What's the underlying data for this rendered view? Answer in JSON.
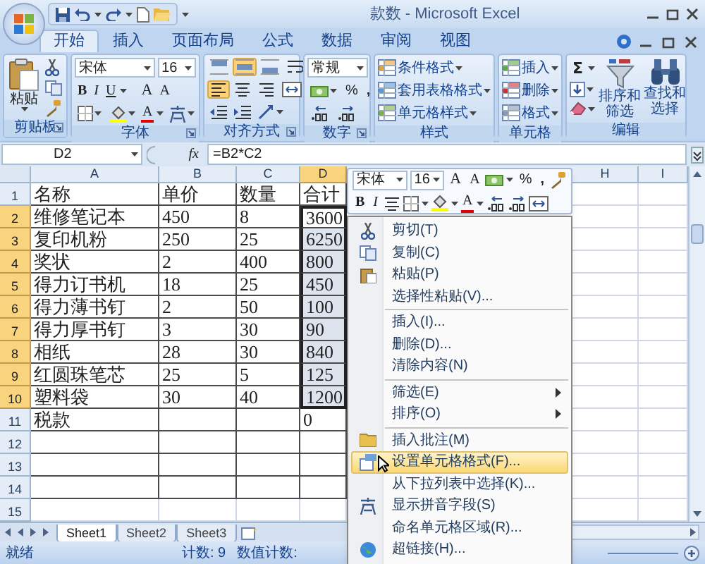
{
  "window": {
    "title": "款数 - Microsoft Excel"
  },
  "ribbon_tabs": [
    {
      "label": "开始",
      "selected": true
    },
    {
      "label": "插入",
      "selected": false
    },
    {
      "label": "页面布局",
      "selected": false
    },
    {
      "label": "公式",
      "selected": false
    },
    {
      "label": "数据",
      "selected": false
    },
    {
      "label": "审阅",
      "selected": false
    },
    {
      "label": "视图",
      "selected": false
    }
  ],
  "ribbon": {
    "clipboard": {
      "label": "剪贴板",
      "paste": "粘贴"
    },
    "font": {
      "label": "字体",
      "font_name": "宋体",
      "font_size": "16",
      "bold": "B",
      "italic": "I",
      "underline": "U",
      "grow_font": "A",
      "shrink_font": "A",
      "font_color": "A"
    },
    "alignment": {
      "label": "对齐方式",
      "vertical_buttons": [
        {
          "selected": false
        },
        {
          "selected": true
        },
        {
          "selected": false
        }
      ],
      "horizontal_buttons": [
        {
          "selected": true
        },
        {
          "selected": false
        },
        {
          "selected": false
        }
      ]
    },
    "number": {
      "label": "数字",
      "format": "常规",
      "percent": "%",
      "comma": ","
    },
    "styles": {
      "label": "样式",
      "items": [
        "条件格式",
        "套用表格格式",
        "单元格样式"
      ]
    },
    "cells": {
      "label": "单元格",
      "items": [
        "插入",
        "删除",
        "格式"
      ]
    },
    "editing": {
      "label": "编辑",
      "sum": "Σ",
      "sort": "排序和筛选",
      "find": "查找和选择"
    }
  },
  "formula_bar": {
    "name_box": "D2",
    "fx": "fx",
    "formula": "=B2*C2"
  },
  "sheet": {
    "columns": [
      {
        "label": "A",
        "selected": false
      },
      {
        "label": "B",
        "selected": false
      },
      {
        "label": "C",
        "selected": false
      },
      {
        "label": "D",
        "selected": true
      },
      {
        "label": "H",
        "selected": false
      },
      {
        "label": "I",
        "selected": false
      }
    ],
    "rows": [
      {
        "number": "1",
        "selected": false,
        "bordered": true,
        "cells": {
          "a": "名称",
          "b": "单价",
          "c": "数量",
          "d": "合计"
        }
      },
      {
        "number": "2",
        "selected": true,
        "bordered": true,
        "cells": {
          "a": "维修笔记本",
          "b": "450",
          "c": "8",
          "d": "3600"
        }
      },
      {
        "number": "3",
        "selected": true,
        "bordered": true,
        "cells": {
          "a": "复印机粉",
          "b": "250",
          "c": "25",
          "d": "6250"
        }
      },
      {
        "number": "4",
        "selected": true,
        "bordered": true,
        "cells": {
          "a": "奖状",
          "b": "2",
          "c": "400",
          "d": "800"
        }
      },
      {
        "number": "5",
        "selected": true,
        "bordered": true,
        "cells": {
          "a": "得力订书机",
          "b": "18",
          "c": "25",
          "d": "450"
        }
      },
      {
        "number": "6",
        "selected": true,
        "bordered": true,
        "cells": {
          "a": "得力薄书钉",
          "b": "2",
          "c": "50",
          "d": "100"
        }
      },
      {
        "number": "7",
        "selected": true,
        "bordered": true,
        "cells": {
          "a": "得力厚书钉",
          "b": "3",
          "c": "30",
          "d": "90"
        }
      },
      {
        "number": "8",
        "selected": true,
        "bordered": true,
        "cells": {
          "a": "相纸",
          "b": "28",
          "c": "30",
          "d": "840"
        }
      },
      {
        "number": "9",
        "selected": true,
        "bordered": true,
        "cells": {
          "a": "红圆珠笔芯",
          "b": "25",
          "c": "5",
          "d": "125"
        }
      },
      {
        "number": "10",
        "selected": true,
        "bordered": true,
        "cells": {
          "a": "塑料袋",
          "b": "30",
          "c": "40",
          "d": "1200"
        }
      },
      {
        "number": "11",
        "selected": false,
        "bordered": true,
        "cells": {
          "a": "税款",
          "d": "0"
        }
      },
      {
        "number": "12",
        "selected": false,
        "bordered": true
      },
      {
        "number": "13",
        "selected": false,
        "bordered": true
      },
      {
        "number": "14",
        "selected": false,
        "bordered": true
      },
      {
        "number": "15",
        "selected": false,
        "bordered": false
      }
    ]
  },
  "mini_toolbar": {
    "font_name": "宋体",
    "font_size": "16",
    "grow_font": "A",
    "shrink_font": "A",
    "percent": "%",
    "comma": ",",
    "bold": "B",
    "italic": "I",
    "font_color": "A"
  },
  "context_menu": {
    "items": [
      {
        "kind": "item",
        "label": "剪切(T)",
        "highlighted": false,
        "has_submenu": false
      },
      {
        "kind": "item",
        "label": "复制(C)",
        "highlighted": false,
        "has_submenu": false
      },
      {
        "kind": "item",
        "label": "粘贴(P)",
        "highlighted": false,
        "has_submenu": false
      },
      {
        "kind": "item",
        "label": "选择性粘贴(V)...",
        "highlighted": false,
        "has_submenu": false
      },
      {
        "kind": "separator"
      },
      {
        "kind": "item",
        "label": "插入(I)...",
        "highlighted": false,
        "has_submenu": false
      },
      {
        "kind": "item",
        "label": "删除(D)...",
        "highlighted": false,
        "has_submenu": false
      },
      {
        "kind": "item",
        "label": "清除内容(N)",
        "highlighted": false,
        "has_submenu": false
      },
      {
        "kind": "separator"
      },
      {
        "kind": "item",
        "label": "筛选(E)",
        "highlighted": false,
        "has_submenu": true
      },
      {
        "kind": "item",
        "label": "排序(O)",
        "highlighted": false,
        "has_submenu": true
      },
      {
        "kind": "separator"
      },
      {
        "kind": "item",
        "label": "插入批注(M)",
        "highlighted": false,
        "has_submenu": false
      },
      {
        "kind": "item",
        "label": "设置单元格格式(F)...",
        "highlighted": true,
        "has_submenu": false
      },
      {
        "kind": "item",
        "label": "从下拉列表中选择(K)...",
        "highlighted": false,
        "has_submenu": false
      },
      {
        "kind": "item",
        "label": "显示拼音字段(S)",
        "highlighted": false,
        "has_submenu": false
      },
      {
        "kind": "item",
        "label": "命名单元格区域(R)...",
        "highlighted": false,
        "has_submenu": false
      },
      {
        "kind": "item",
        "label": "超链接(H)...",
        "highlighted": false,
        "has_submenu": false
      }
    ]
  },
  "sheet_tabs": [
    {
      "label": "Sheet1",
      "selected": true
    },
    {
      "label": "Sheet2",
      "selected": false
    },
    {
      "label": "Sheet3",
      "selected": false
    }
  ],
  "status_bar": {
    "state": "就绪",
    "count": "计数: 9",
    "numeric_count": "数值计数:"
  }
}
